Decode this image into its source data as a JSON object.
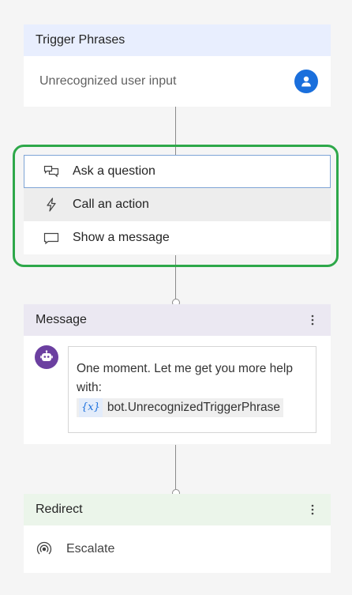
{
  "trigger": {
    "header": "Trigger Phrases",
    "value": "Unrecognized user input",
    "avatar_icon": "person-icon"
  },
  "menu": {
    "items": [
      {
        "label": "Ask a question",
        "icon": "question-chat-icon",
        "state": "selected"
      },
      {
        "label": "Call an action",
        "icon": "lightning-icon",
        "state": "hover"
      },
      {
        "label": "Show a message",
        "icon": "chat-bubble-icon",
        "state": "normal"
      }
    ],
    "highlight_color": "#2ea84a"
  },
  "message": {
    "header": "Message",
    "text": "One moment. Let me get you more help with:",
    "variable_icon": "{x}",
    "variable": "bot.UnrecognizedTriggerPhrase",
    "bot_icon": "bot-icon"
  },
  "redirect": {
    "header": "Redirect",
    "target": "Escalate",
    "target_icon": "broadcast-icon"
  },
  "colors": {
    "trigger_header": "#e8eefe",
    "message_header": "#ebe8f2",
    "redirect_header": "#ebf5ea",
    "accent_blue": "#1a6fdc",
    "bot_purple": "#6b3fa0"
  }
}
